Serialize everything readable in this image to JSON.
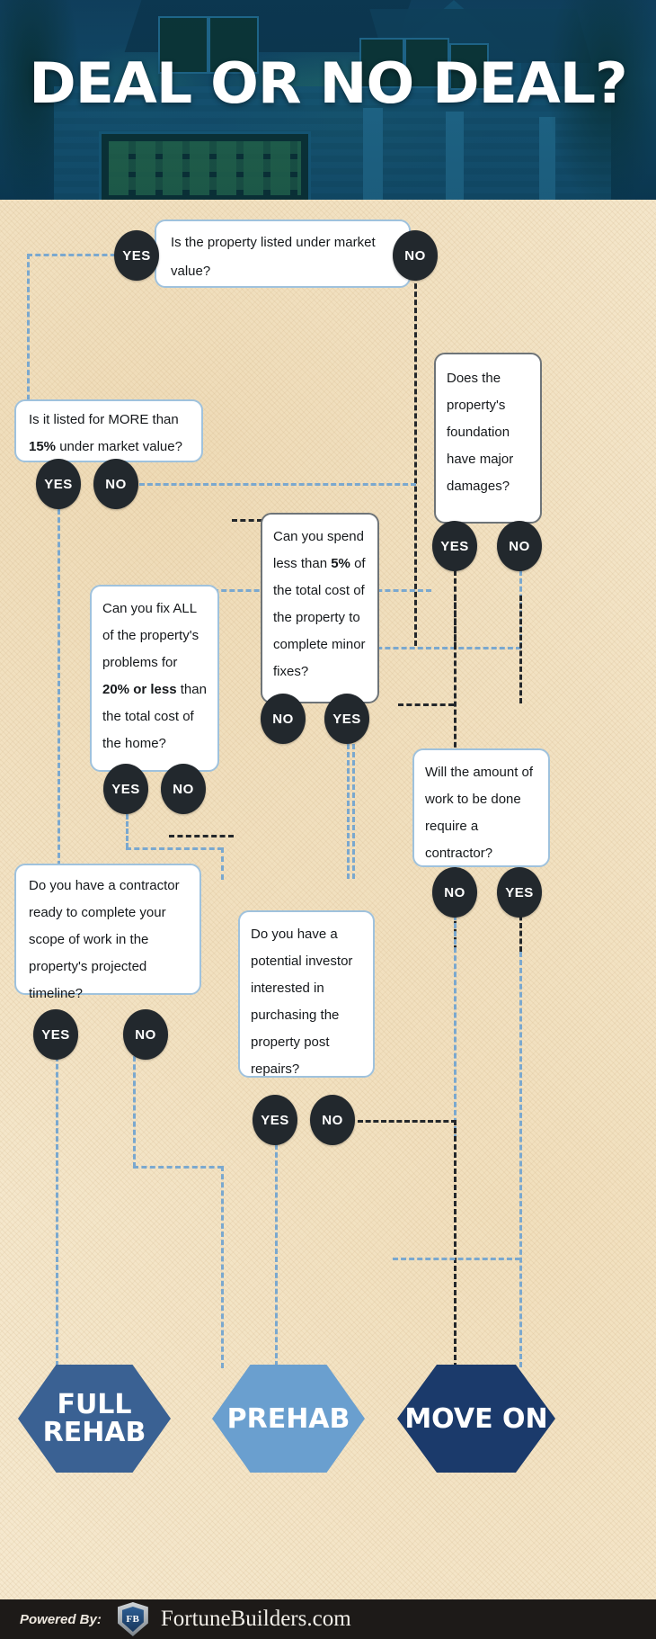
{
  "header": {
    "title": "DEAL OR NO DEAL?",
    "photo_alt": "craftsman-house-at-dusk"
  },
  "theme": {
    "paper_bg": "#f6ead1",
    "box_border_blue": "#9fc2dd",
    "box_border_dark": "#6e7478",
    "pill_bg": "#22282d",
    "connector_blue": "#7aa8cf",
    "connector_dark": "#23272b",
    "hex_full_rehab": "#3a6193",
    "hex_prehab": "#6a9fcf",
    "hex_move_on": "#1b3a6b",
    "footer_bg": "#1d1a18"
  },
  "labels": {
    "yes": "YES",
    "no": "NO"
  },
  "nodes": {
    "q1": {
      "text": "Is the property listed under market value?"
    },
    "q2": {
      "text_pre": "Is it listed for MORE than ",
      "text_bold": "15%",
      "text_post": " under market value?"
    },
    "q3": {
      "text": "Does the property's foundation have major damages?"
    },
    "q4": {
      "p1": "Can you spend less than ",
      "b1": "5%",
      "p2": " of the total cost of the property to complete minor fixes?"
    },
    "q5": {
      "p1": "Can you fix ALL of the property's problems for ",
      "b1": "20% or less",
      "p2": " than the total cost of the home?"
    },
    "q6": {
      "text": "Will the amount of work to be done require a contractor?"
    },
    "q7": {
      "text": "Do you have a contractor ready to complete your scope of work in the property's projected timeline?"
    },
    "q8": {
      "text": "Do you have a potential investor interested in purchasing the property post repairs?"
    }
  },
  "outcomes": {
    "full_rehab": "FULL REHAB",
    "prehab": "PREHAB",
    "move_on": "MOVE ON"
  },
  "footer": {
    "powered_by": "Powered By:",
    "logo_text": "FB",
    "brand": "FortuneBuilders.com"
  },
  "chart_data": {
    "type": "diagram",
    "title": "DEAL OR NO DEAL?",
    "diagram_kind": "decision-flowchart",
    "decisions": [
      {
        "id": "q1",
        "question": "Is the property listed under market value?",
        "yes": "q2",
        "no": "q3"
      },
      {
        "id": "q2",
        "question": "Is it listed for MORE than 15% under market value?",
        "yes": "q7",
        "no": "q4"
      },
      {
        "id": "q3",
        "question": "Does the property's foundation have major damages?",
        "yes": "MOVE ON",
        "no": "q4"
      },
      {
        "id": "q4",
        "question": "Can you spend less than 5% of the total cost of the property to complete minor fixes?",
        "yes": "q8",
        "no": "q5"
      },
      {
        "id": "q5",
        "question": "Can you fix ALL of the property's problems for 20% or less than the total cost of the home?",
        "yes": "q7",
        "no": "q6"
      },
      {
        "id": "q6",
        "question": "Will the amount of work to be done require a contractor?",
        "yes": "MOVE ON",
        "no": "q8"
      },
      {
        "id": "q7",
        "question": "Do you have a contractor ready to complete your scope of work in the property's projected timeline?",
        "yes": "FULL REHAB",
        "no": "q8"
      },
      {
        "id": "q8",
        "question": "Do you have a potential investor interested in purchasing the property post repairs?",
        "yes": "PREHAB",
        "no": "MOVE ON"
      }
    ],
    "terminals": [
      "FULL REHAB",
      "PREHAB",
      "MOVE ON"
    ]
  }
}
